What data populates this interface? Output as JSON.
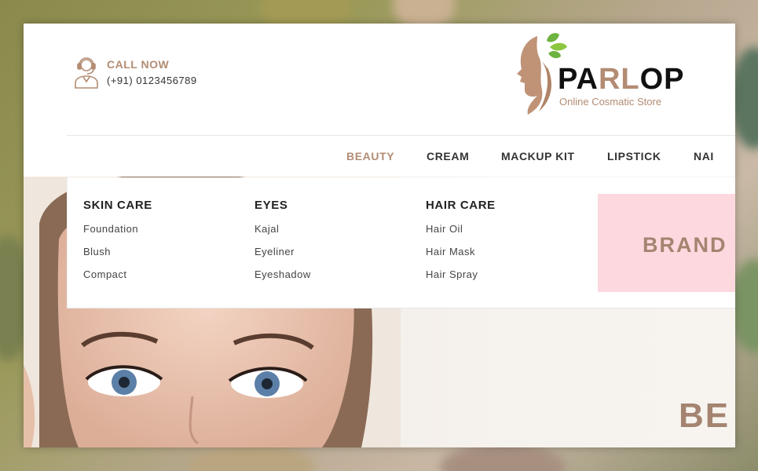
{
  "header": {
    "call_title": "CALL NOW",
    "call_phone": "(+91) 0123456789",
    "call_icon": "support-agent-icon",
    "logo": {
      "name_a": "PA",
      "name_b": "RL",
      "name_c": "OP",
      "tagline": "Online Cosmatic Store"
    }
  },
  "nav": {
    "items": [
      {
        "label": "BEAUTY",
        "active": true
      },
      {
        "label": "CREAM"
      },
      {
        "label": "MACKUP KIT"
      },
      {
        "label": "LIPSTICK"
      },
      {
        "label": "NAI"
      }
    ]
  },
  "mega_menu": {
    "columns": [
      {
        "title": "SKIN CARE",
        "links": [
          "Foundation",
          "Blush",
          "Compact"
        ]
      },
      {
        "title": "EYES",
        "links": [
          "Kajal",
          "Eyeliner",
          "Eyeshadow"
        ]
      },
      {
        "title": "HAIR CARE",
        "links": [
          "Hair Oil",
          "Hair Mask",
          "Hair Spray"
        ]
      }
    ],
    "promo_text": "BRAND"
  },
  "hero": {
    "text": "BE"
  },
  "colors": {
    "accent": "#b38c73",
    "promo_bg": "#fdd9df",
    "text_dark": "#222222"
  }
}
